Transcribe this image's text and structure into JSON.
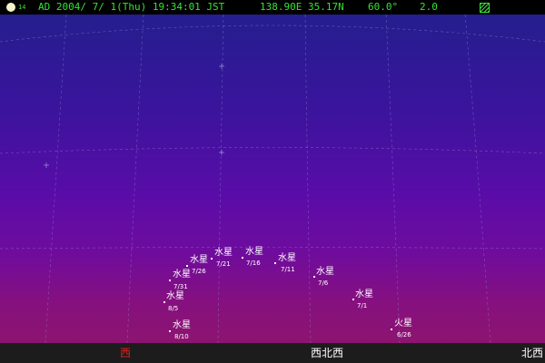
{
  "status_bar": {
    "moon_age": "14",
    "datetime": "AD 2004/ 7/ 1(Thu) 19:34:01 JST",
    "location": "138.90E 35.17N",
    "field_of_view": "60.0°",
    "magnitude_limit": "2.0",
    "text_color": "#35e335",
    "display_mode_icon": "hatched-square-icon"
  },
  "planets": [
    {
      "name": "水星",
      "date": "7/1"
    },
    {
      "name": "水星",
      "date": "7/6"
    },
    {
      "name": "水星",
      "date": "7/11"
    },
    {
      "name": "水星",
      "date": "7/16"
    },
    {
      "name": "水星",
      "date": "7/21"
    },
    {
      "name": "水星",
      "date": "7/26"
    },
    {
      "name": "水星",
      "date": "7/31"
    },
    {
      "name": "水星",
      "date": "8/5"
    },
    {
      "name": "水星",
      "date": "8/10"
    },
    {
      "name": "火星",
      "date": "6/26"
    }
  ],
  "directions": {
    "west": "西",
    "west_northwest": "西北西",
    "northwest": "北西",
    "west_color": "#e02020",
    "label_color": "#ffffff"
  }
}
